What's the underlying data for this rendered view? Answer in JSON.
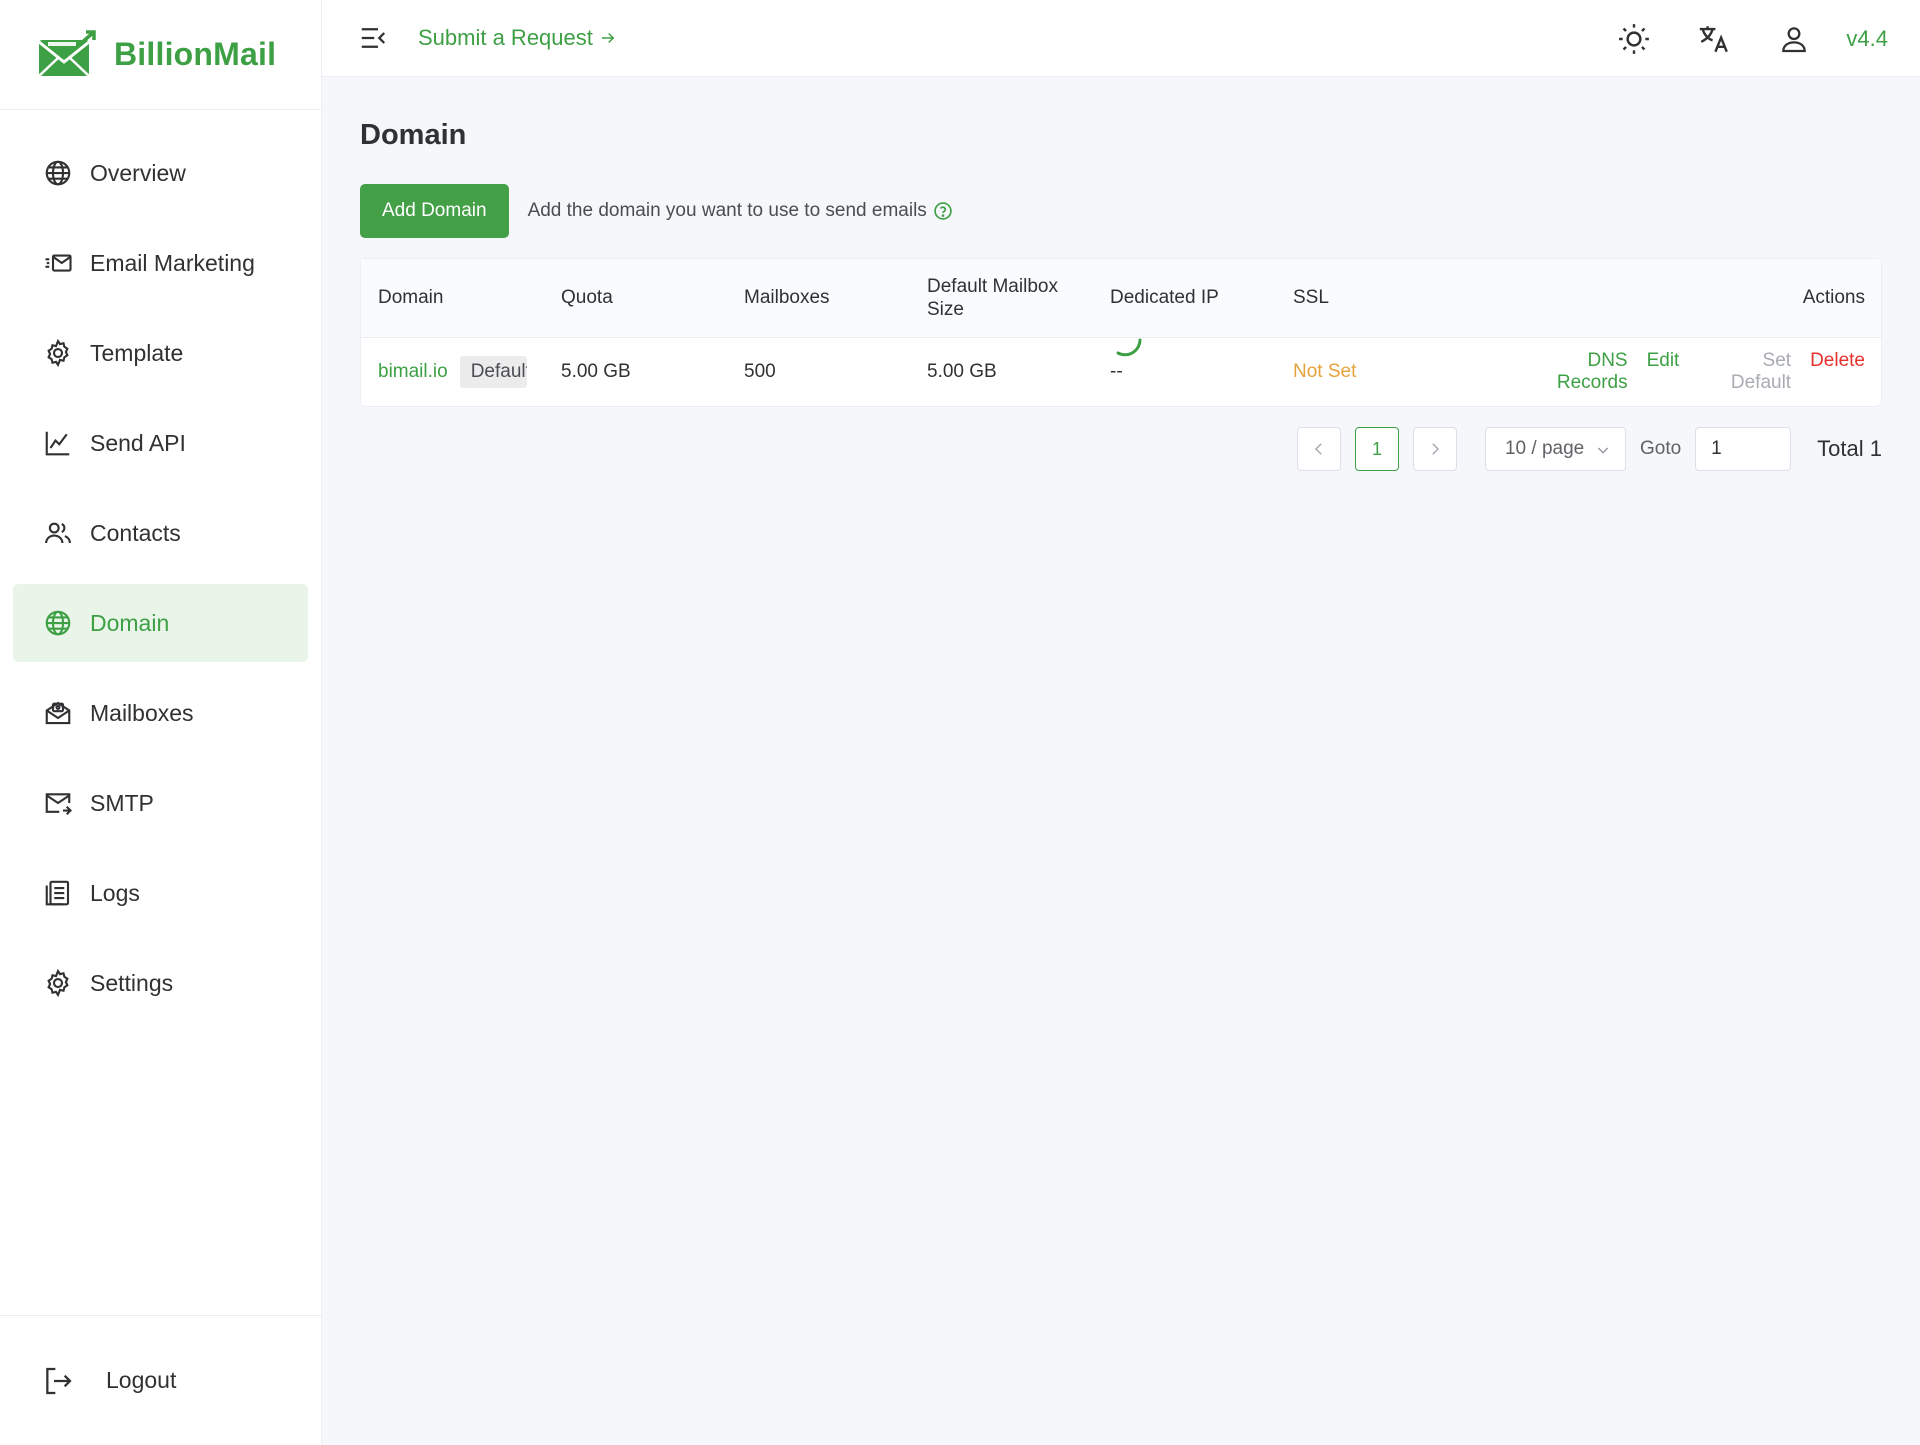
{
  "brand": {
    "name": "BillionMail",
    "accent": "#3ea045"
  },
  "sidebar": {
    "items": [
      {
        "label": "Overview",
        "icon": "globe-icon",
        "active": false
      },
      {
        "label": "Email Marketing",
        "icon": "email-marketing-icon",
        "active": false
      },
      {
        "label": "Template",
        "icon": "gear-icon",
        "active": false
      },
      {
        "label": "Send API",
        "icon": "line-chart-icon",
        "active": false
      },
      {
        "label": "Contacts",
        "icon": "users-icon",
        "active": false
      },
      {
        "label": "Domain",
        "icon": "globe-icon",
        "active": true
      },
      {
        "label": "Mailboxes",
        "icon": "mailbox-icon",
        "active": false
      },
      {
        "label": "SMTP",
        "icon": "mail-send-icon",
        "active": false
      },
      {
        "label": "Logs",
        "icon": "document-icon",
        "active": false
      },
      {
        "label": "Settings",
        "icon": "gear-icon",
        "active": false
      }
    ],
    "logout_label": "Logout"
  },
  "header": {
    "submit_label": "Submit a Request",
    "version": "v4.4",
    "icons": [
      "menu-collapse-icon",
      "sun-icon",
      "translate-icon",
      "user-icon"
    ]
  },
  "page": {
    "title": "Domain",
    "add_button": "Add Domain",
    "tip": "Add the domain you want to use to send emails"
  },
  "table": {
    "columns": [
      "Domain",
      "Quota",
      "Mailboxes",
      "Default Mailbox Size",
      "Dedicated IP",
      "SSL",
      "Actions"
    ],
    "rows": [
      {
        "domain": "bimail.io",
        "tag": "Default",
        "quota": "5.00 GB",
        "mailboxes": "500",
        "mailbox_size": "5.00 GB",
        "dedicated_ip": "--",
        "ssl": "Not Set",
        "actions": [
          "DNS Records",
          "Edit",
          "Set Default",
          "Delete"
        ]
      }
    ]
  },
  "pagination": {
    "current_page": "1",
    "page_size": "10 / page",
    "goto_label": "Goto",
    "goto_value": "1",
    "total": "Total 1"
  }
}
